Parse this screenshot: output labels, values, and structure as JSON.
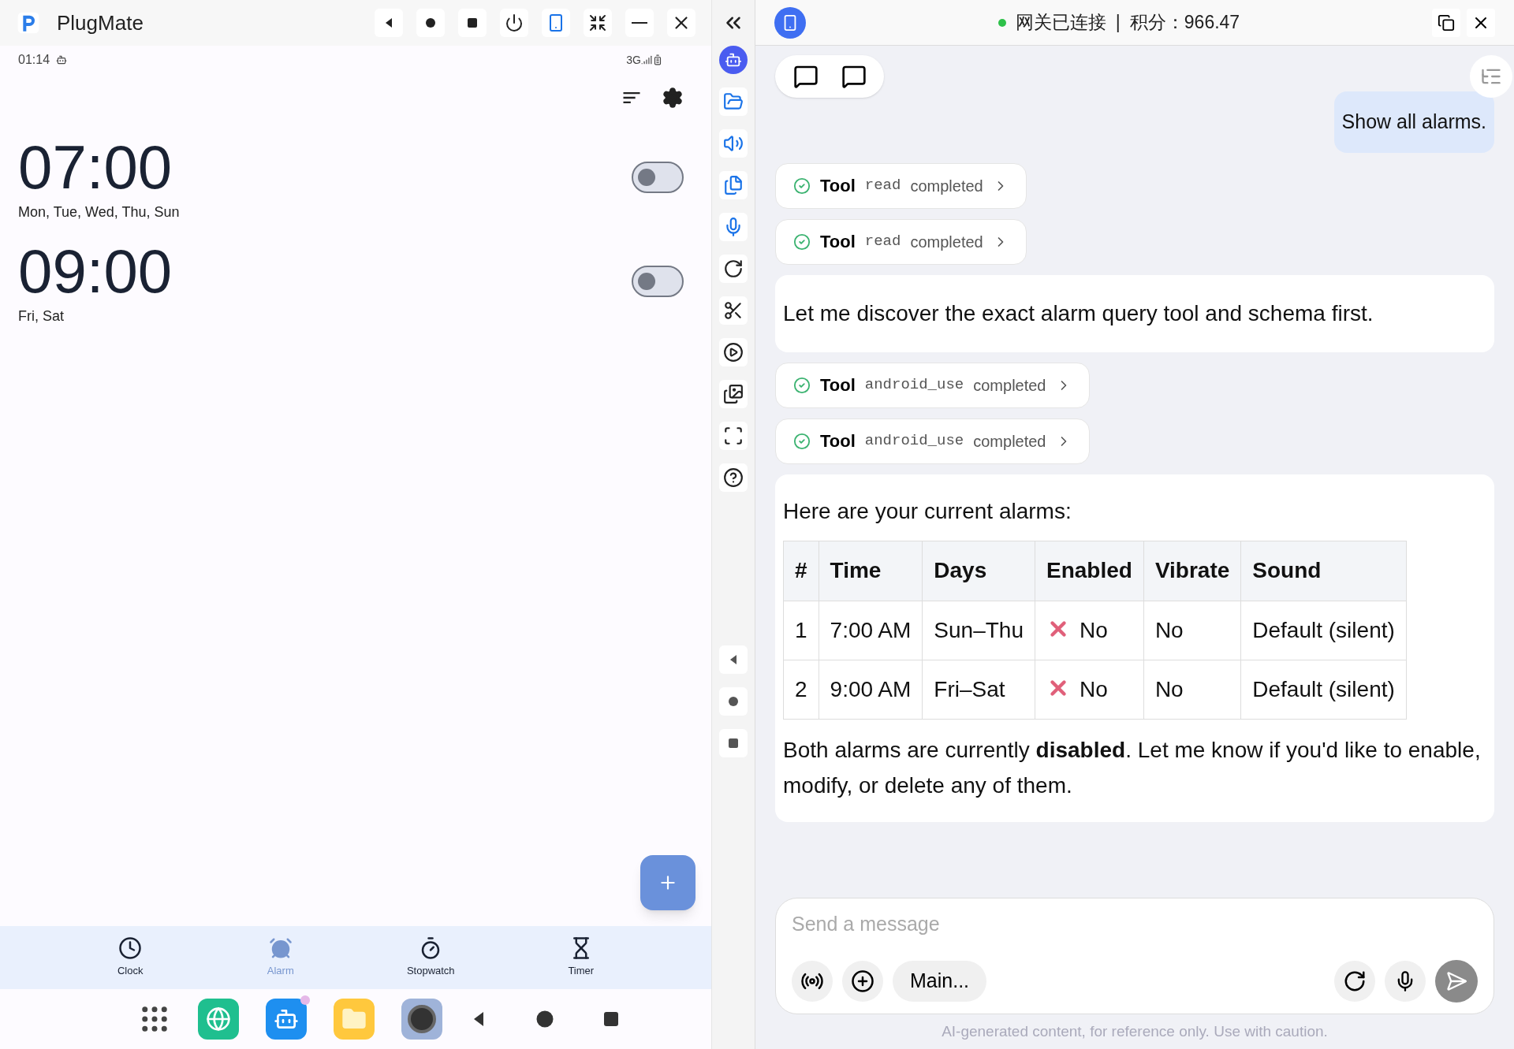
{
  "window": {
    "title": "PlugMate"
  },
  "phone": {
    "status_bar": {
      "time": "01:14",
      "network": "3G"
    },
    "alarms": [
      {
        "time": "07:00",
        "days": "Mon, Tue, Wed, Thu, Sun",
        "on": false
      },
      {
        "time": "09:00",
        "days": "Fri, Sat",
        "on": false
      }
    ],
    "bottom_nav": [
      {
        "label": "Clock",
        "selected": false
      },
      {
        "label": "Alarm",
        "selected": true
      },
      {
        "label": "Stopwatch",
        "selected": false
      },
      {
        "label": "Timer",
        "selected": false
      }
    ]
  },
  "chat": {
    "header": {
      "connected": true,
      "status": "网关已连接",
      "separator": "|",
      "points": "积分：966.47"
    },
    "messages": [
      {
        "kind": "user",
        "text": "Show all alarms."
      },
      {
        "kind": "tool",
        "label": "Tool",
        "name": "read",
        "status": "completed"
      },
      {
        "kind": "tool",
        "label": "Tool",
        "name": "read",
        "status": "completed"
      },
      {
        "kind": "assistant",
        "text": "Let me discover the exact alarm query tool and schema first."
      },
      {
        "kind": "tool",
        "label": "Tool",
        "name": "android_use",
        "status": "completed"
      },
      {
        "kind": "tool",
        "label": "Tool",
        "name": "android_use",
        "status": "completed"
      },
      {
        "kind": "table",
        "intro": "Here are your current alarms:",
        "columns": [
          "#",
          "Time",
          "Days",
          "Enabled",
          "Vibrate",
          "Sound"
        ],
        "rows": [
          [
            {
              "text": "1"
            },
            {
              "text": "7:00 AM"
            },
            {
              "text": "Sun–Thu"
            },
            {
              "text": "No",
              "kind": "cross"
            },
            {
              "text": "No"
            },
            {
              "text": "Default (silent)"
            }
          ],
          [
            {
              "text": "2"
            },
            {
              "text": "9:00 AM"
            },
            {
              "text": "Fri–Sat"
            },
            {
              "text": "No",
              "kind": "cross"
            },
            {
              "text": "No"
            },
            {
              "text": "Default (silent)"
            }
          ]
        ],
        "outro": "Both alarms are currently **disabled**. Let me know if you'd like to enable, modify, or delete any of them."
      }
    ],
    "input": {
      "placeholder": "Send a message",
      "model": "Main..."
    },
    "disclaimer": "AI-generated content, for reference only. Use with caution."
  }
}
